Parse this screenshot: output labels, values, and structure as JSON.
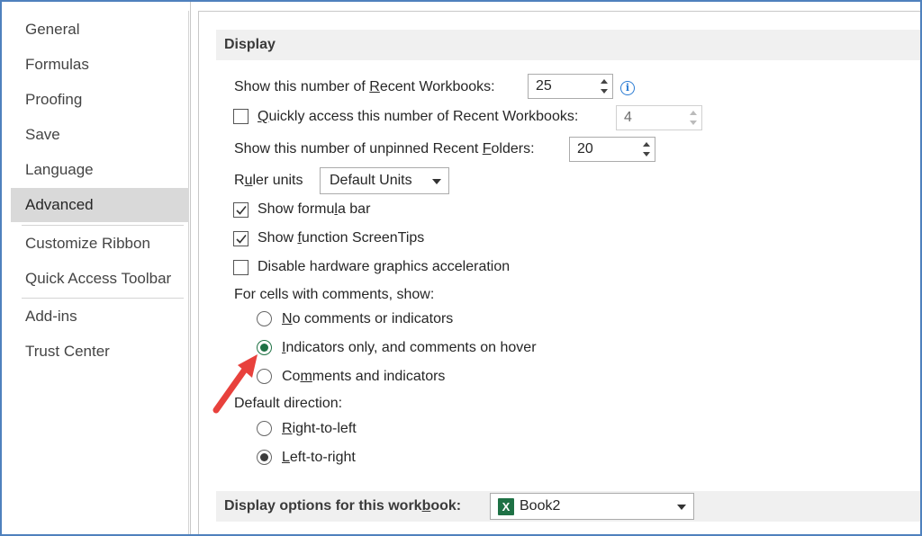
{
  "nav": {
    "items": [
      {
        "label": "General"
      },
      {
        "label": "Formulas"
      },
      {
        "label": "Proofing"
      },
      {
        "label": "Save"
      },
      {
        "label": "Language"
      },
      {
        "label": "Advanced",
        "selected": true
      },
      {
        "label": "Customize Ribbon"
      },
      {
        "label": "Quick Access Toolbar"
      },
      {
        "label": "Add-ins"
      },
      {
        "label": "Trust Center"
      }
    ]
  },
  "display": {
    "header": "Display",
    "recent_workbooks": {
      "label": "Show this number of Recent Workbooks:",
      "value": "25"
    },
    "quick_access": {
      "label": "Quickly access this number of Recent Workbooks:",
      "value": "4",
      "checked": false
    },
    "recent_folders": {
      "label": "Show this number of unpinned Recent Folders:",
      "value": "20"
    },
    "ruler_units": {
      "label": "Ruler units",
      "value": "Default Units"
    },
    "show_formula_bar": {
      "label": "Show formula bar",
      "checked": true
    },
    "show_screentips": {
      "label": "Show function ScreenTips",
      "checked": true
    },
    "disable_hw_accel": {
      "label": "Disable hardware graphics acceleration",
      "checked": false
    },
    "comments_heading": "For cells with comments, show:",
    "comments_options": [
      {
        "label": "No comments or indicators",
        "selected": false
      },
      {
        "label": "Indicators only, and comments on hover",
        "selected": true
      },
      {
        "label": "Comments and indicators",
        "selected": false
      }
    ],
    "direction_heading": "Default direction:",
    "direction_options": [
      {
        "label": "Right-to-left",
        "selected": false
      },
      {
        "label": "Left-to-right",
        "selected": true
      }
    ]
  },
  "workbook_options": {
    "header": "Display options for this workbook:",
    "workbook": "Book2",
    "icon": "excel-icon"
  },
  "colors": {
    "accent_arrow": "#e8413c",
    "selected_nav": "#d9d9d9",
    "excel_green": "#1e7145",
    "frame_border": "#4f81bd"
  }
}
